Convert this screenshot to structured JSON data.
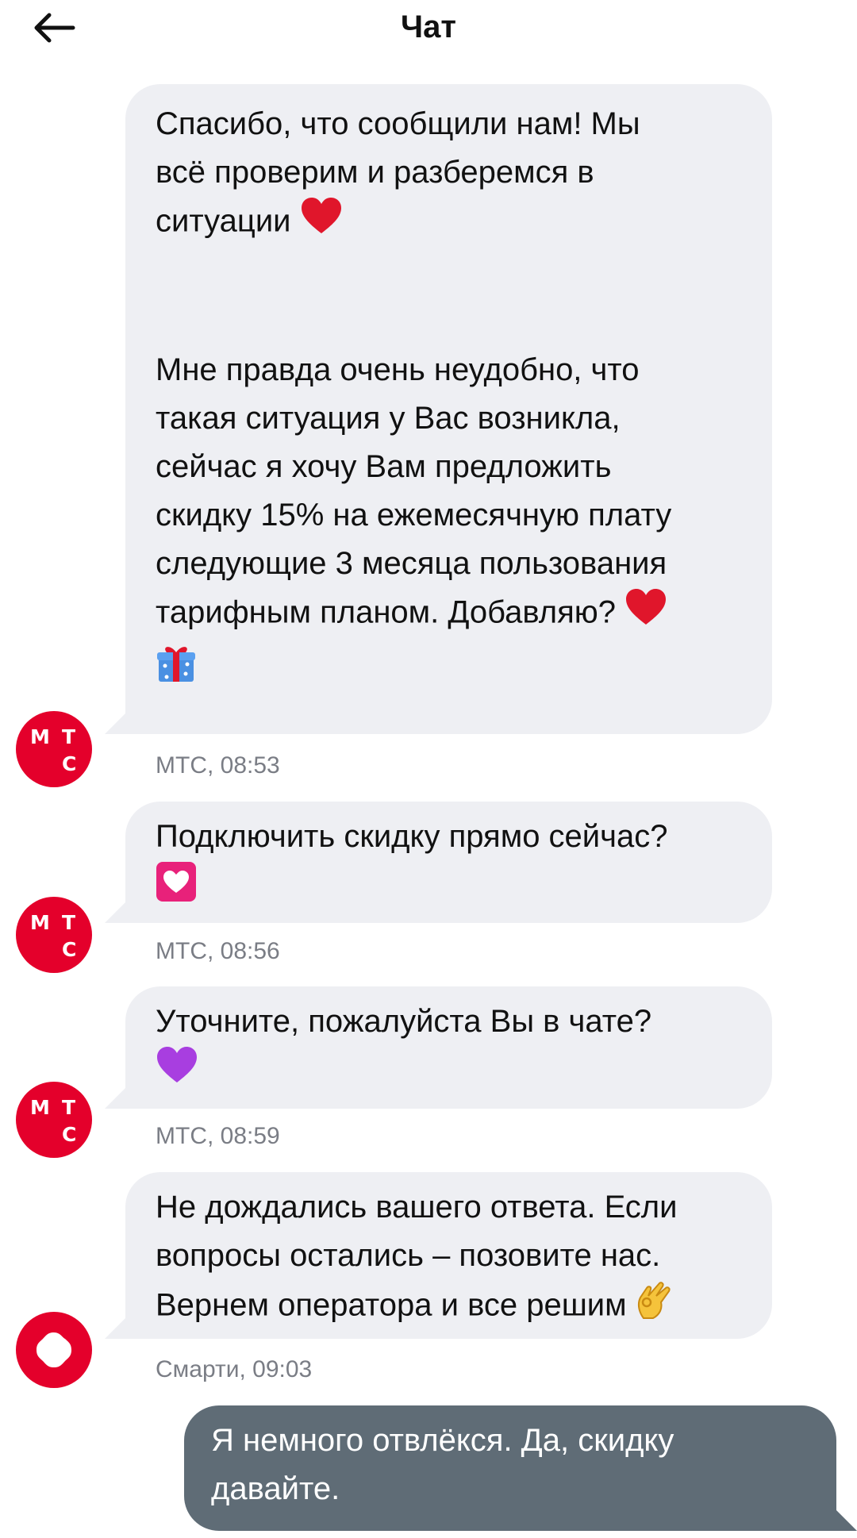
{
  "header": {
    "title": "Чат",
    "back_icon": "arrow-left-icon"
  },
  "messages": [
    {
      "sender": "МТС",
      "time": "08:53",
      "meta": "МТС, 08:53",
      "text_1": "Спасибо, что сообщили нам! Мы\nвсё проверим и разберемся в\nситуации",
      "text_2": "Мне правда очень неудобно, что\nтакая ситуация у Вас возникла,\nсейчас я хочу Вам предложить\nскидку 15% на ежемесячную плату\nследующие 3 месяца пользования\nтарифным планом. Добавляю?",
      "emojis": [
        "red-heart-icon",
        "red-heart-icon",
        "gift-icon"
      ]
    },
    {
      "sender": "МТС",
      "time": "08:56",
      "meta": "МТС, 08:56",
      "text": "Подключить скидку прямо сейчас?",
      "emojis": [
        "heart-with-ribbon-icon"
      ]
    },
    {
      "sender": "МТС",
      "time": "08:59",
      "meta": "МТС, 08:59",
      "text": "Уточните, пожалуйста Вы в чате?",
      "emojis": [
        "purple-heart-icon"
      ]
    },
    {
      "sender": "Смарти",
      "time": "09:03",
      "meta": "Смарти, 09:03",
      "text": "Не дождались вашего ответа. Если\nвопросы остались – позовите нас.\nВернем оператора и все решим",
      "emojis": [
        "ok-hand-icon"
      ]
    },
    {
      "sender": "user",
      "text": "Я немного отвлёкся. Да, скидку\nдавайте."
    }
  ],
  "avatars": {
    "mts_letters": [
      "М",
      "Т",
      "С"
    ],
    "mts_color": "#e4002b",
    "smarti_color": "#e4002b"
  },
  "colors": {
    "incoming_bubble": "#eeeff3",
    "outgoing_bubble": "#5f6c76",
    "meta_text": "#7a7d85"
  }
}
